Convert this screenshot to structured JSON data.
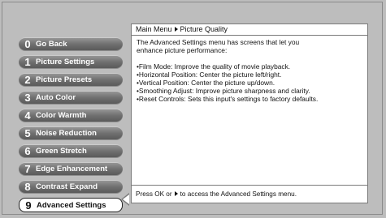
{
  "menu": {
    "items": [
      {
        "num": "0",
        "label": "Go Back"
      },
      {
        "num": "1",
        "label": "Picture Settings"
      },
      {
        "num": "2",
        "label": "Picture Presets"
      },
      {
        "num": "3",
        "label": "Auto Color"
      },
      {
        "num": "4",
        "label": "Color Warmth"
      },
      {
        "num": "5",
        "label": "Noise Reduction"
      },
      {
        "num": "6",
        "label": "Green Stretch"
      },
      {
        "num": "7",
        "label": "Edge Enhancement"
      },
      {
        "num": "8",
        "label": "Contrast Expand"
      },
      {
        "num": "9",
        "label": "Advanced Settings"
      }
    ]
  },
  "panel": {
    "breadcrumb_root": "Main Menu",
    "breadcrumb_current": "Picture Quality",
    "intro_line1": "The Advanced Settings menu has screens that let you",
    "intro_line2": "enhance picture performance:",
    "bullets": [
      "•Film Mode: Improve the quality of movie playback.",
      "•Horizontal Position: Center the picture left/right.",
      "•Vertical Position: Center the picture up/down.",
      "•Smoothing Adjust: Improve picture sharpness and clarity.",
      "•Reset Controls: Sets this input's settings to factory defaults."
    ],
    "footer_pre": "Press OK or",
    "footer_post": "to access the Advanced Settings menu."
  }
}
